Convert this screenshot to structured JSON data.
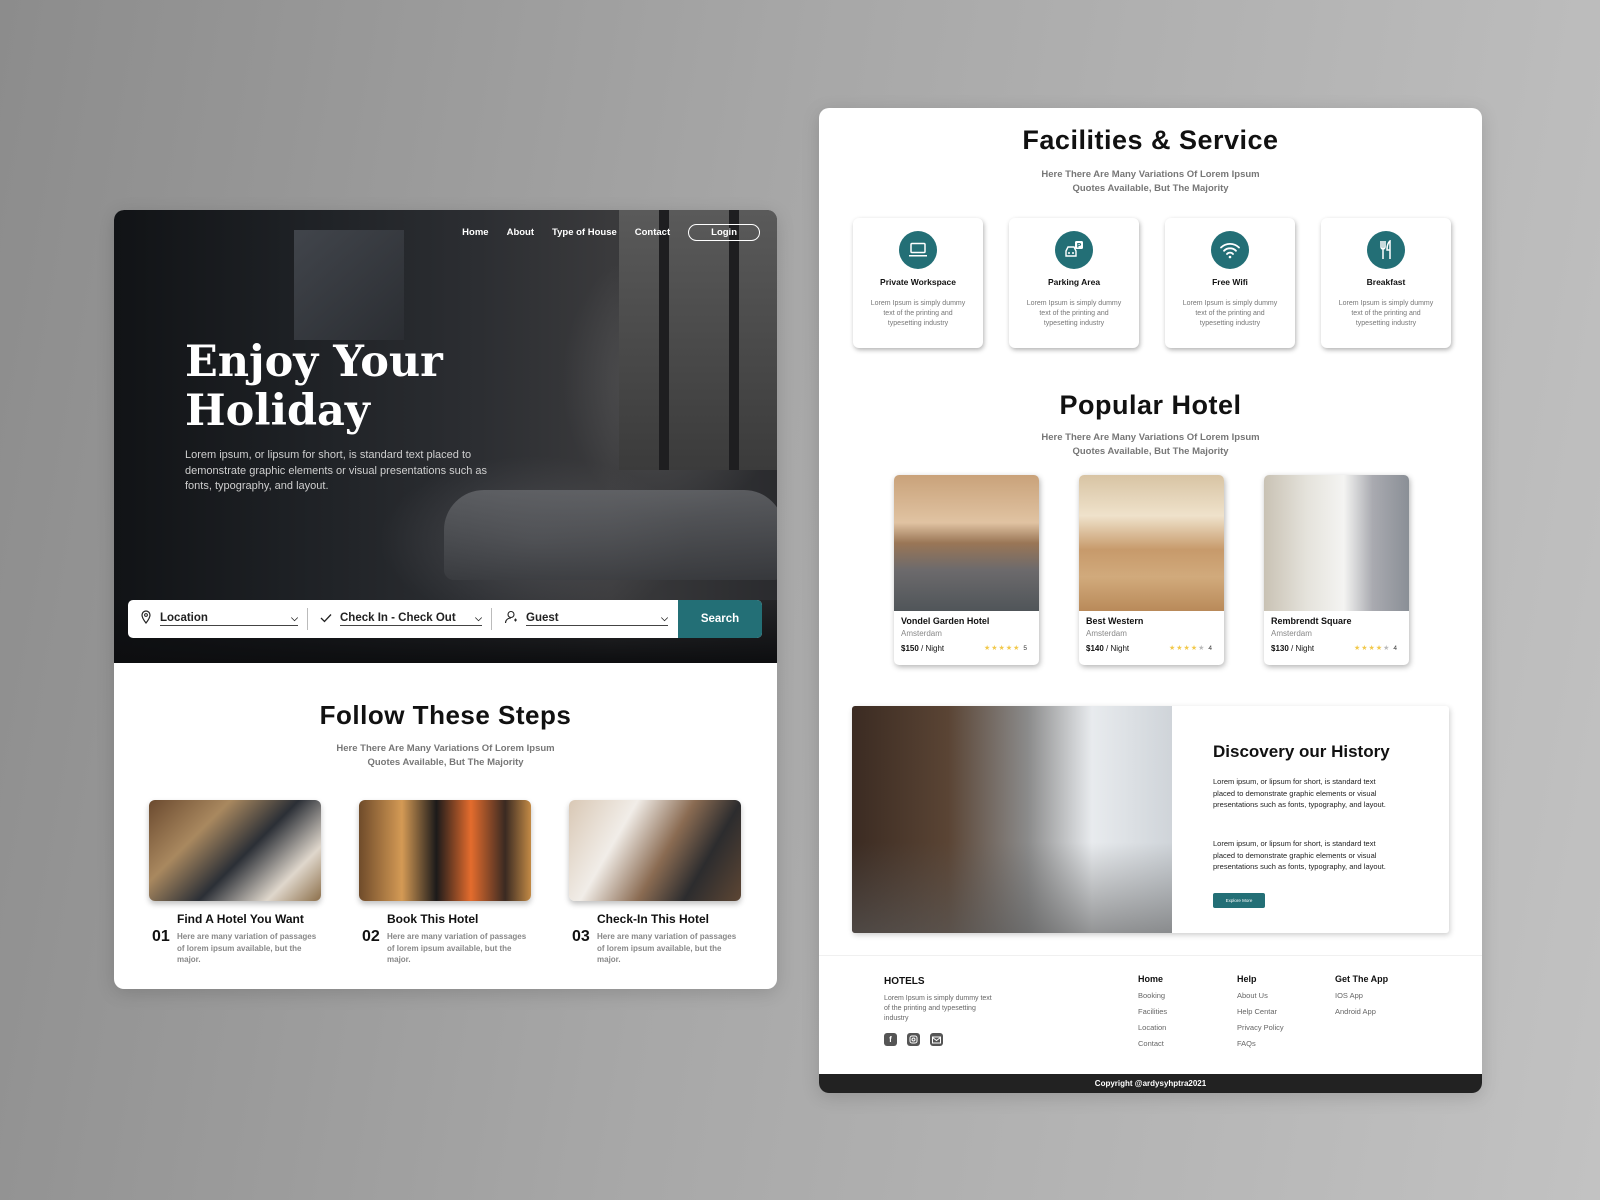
{
  "landing": {
    "nav": {
      "links": [
        "Home",
        "About",
        "Type of House",
        "Contact"
      ],
      "login_label": "Login"
    },
    "hero": {
      "title": "Enjoy Your Holiday",
      "description": "Lorem ipsum, or lipsum for short, is standard text placed to demonstrate graphic elements or visual presentations such as fonts, typography, and layout."
    },
    "search": {
      "location": "Location",
      "dates": "Check In - Check Out",
      "guest": "Guest",
      "button_label": "Search"
    },
    "steps": {
      "title": "Follow These Steps",
      "subtitle": "Here There Are Many Variations Of Lorem Ipsum Quotes Available, But The Majority",
      "items": [
        {
          "number": "01",
          "title": "Find A Hotel You Want",
          "description": "Here are many variation of passages of lorem ipsum available, but the major."
        },
        {
          "number": "02",
          "title": "Book This Hotel",
          "description": "Here are many variation of passages of lorem ipsum available, but the major."
        },
        {
          "number": "03",
          "title": "Check-In This Hotel",
          "description": "Here are many variation of passages of lorem ipsum available, but the major."
        }
      ]
    }
  },
  "details": {
    "facilities": {
      "title": "Facilities & Service",
      "subtitle": "Here There Are Many Variations Of Lorem Ipsum Quotes Available, But The Majority",
      "items": [
        {
          "icon": "laptop-icon",
          "title": "Private Workspace",
          "description": "Lorem Ipsum is simply dummy text of  the printing and typesetting industry"
        },
        {
          "icon": "parking-icon",
          "title": "Parking Area",
          "description": "Lorem Ipsum is simply dummy text of  the printing and typesetting industry"
        },
        {
          "icon": "wifi-icon",
          "title": "Free Wifi",
          "description": "Lorem Ipsum is simply dummy text of  the printing and typesetting industry"
        },
        {
          "icon": "cutlery-icon",
          "title": "Breakfast",
          "description": "Lorem Ipsum is simply dummy text of  the printing and typesetting industry"
        }
      ]
    },
    "popular": {
      "title": "Popular Hotel",
      "subtitle": "Here There Are Many Variations Of Lorem Ipsum Quotes Available, But The Majority",
      "hotels": [
        {
          "name": "Vondel Garden Hotel",
          "city": "Amsterdam",
          "price": "$150",
          "unit": " / Night",
          "rating": 5
        },
        {
          "name": "Best Western",
          "city": "Amsterdam",
          "price": "$140",
          "unit": " / Night",
          "rating": 4
        },
        {
          "name": "Rembrendt Square",
          "city": "Amsterdam",
          "price": "$130",
          "unit": " / Night",
          "rating": 4
        }
      ]
    },
    "history": {
      "title": "Discovery our History",
      "paragraphs": [
        "Lorem ipsum, or lipsum for short, is standard text placed to demonstrate graphic elements or visual presentations such as fonts, typography, and layout.",
        "Lorem ipsum, or lipsum for short, is standard text placed to demonstrate graphic elements or visual presentations such as fonts, typography, and layout."
      ],
      "button_label": "Explore More"
    },
    "footer": {
      "brand": "HOTELS",
      "description": "Lorem Ipsum is simply dummy text of  the printing and typesetting industry",
      "social": [
        "facebook-icon",
        "instagram-icon",
        "mail-icon"
      ],
      "columns": [
        {
          "heading": "Home",
          "links": [
            "Booking",
            "Facilities",
            "Location",
            "Contact"
          ]
        },
        {
          "heading": "Help",
          "links": [
            "About Us",
            "Help Centar",
            "Privacy Policy",
            "FAQs"
          ]
        },
        {
          "heading": "Get The App",
          "links": [
            "IOS App",
            "Android App"
          ]
        }
      ],
      "copyright": "Copyright @ardysyhptra2021"
    }
  },
  "colors": {
    "accent": "#236f76",
    "star": "#f2c94c",
    "footer_bar": "#222222"
  }
}
